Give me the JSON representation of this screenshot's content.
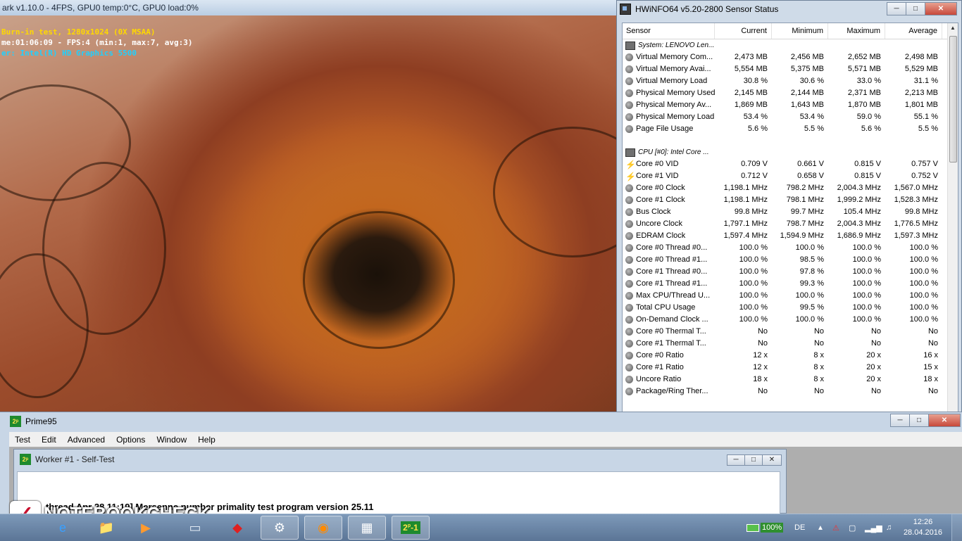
{
  "furmark": {
    "title": "ark v1.10.0 - 4FPS, GPU0 temp:0°C, GPU0 load:0%",
    "line1": "Burn-in test, 1280x1024 (0X MSAA)",
    "line2": "me:01:06:09 - FPS:4 (min:1, max:7, avg:3)",
    "line3": "er: Intel(R) HD Graphics 5500"
  },
  "hwinfo": {
    "title": "HWiNFO64 v5.20-2800 Sensor Status",
    "columns": [
      "Sensor",
      "Current",
      "Minimum",
      "Maximum",
      "Average"
    ],
    "group1": "System: LENOVO Len...",
    "group1_rows": [
      {
        "icon": "sensor-icon",
        "name": "Virtual Memory Com...",
        "current": "2,473 MB",
        "min": "2,456 MB",
        "max": "2,652 MB",
        "avg": "2,498 MB"
      },
      {
        "icon": "sensor-icon",
        "name": "Virtual Memory Avai...",
        "current": "5,554 MB",
        "min": "5,375 MB",
        "max": "5,571 MB",
        "avg": "5,529 MB"
      },
      {
        "icon": "sensor-icon",
        "name": "Virtual Memory Load",
        "current": "30.8 %",
        "min": "30.6 %",
        "max": "33.0 %",
        "avg": "31.1 %"
      },
      {
        "icon": "sensor-icon",
        "name": "Physical Memory Used",
        "current": "2,145 MB",
        "min": "2,144 MB",
        "max": "2,371 MB",
        "avg": "2,213 MB"
      },
      {
        "icon": "sensor-icon",
        "name": "Physical Memory Av...",
        "current": "1,869 MB",
        "min": "1,643 MB",
        "max": "1,870 MB",
        "avg": "1,801 MB"
      },
      {
        "icon": "sensor-icon",
        "name": "Physical Memory Load",
        "current": "53.4 %",
        "min": "53.4 %",
        "max": "59.0 %",
        "avg": "55.1 %"
      },
      {
        "icon": "sensor-icon",
        "name": "Page File Usage",
        "current": "5.6 %",
        "min": "5.5 %",
        "max": "5.6 %",
        "avg": "5.5 %"
      }
    ],
    "group2": "CPU [#0]: Intel Core ...",
    "group2_rows": [
      {
        "icon": "voltage-icon",
        "name": "Core #0 VID",
        "current": "0.709 V",
        "min": "0.661 V",
        "max": "0.815 V",
        "avg": "0.757 V"
      },
      {
        "icon": "voltage-icon",
        "name": "Core #1 VID",
        "current": "0.712 V",
        "min": "0.658 V",
        "max": "0.815 V",
        "avg": "0.752 V"
      },
      {
        "icon": "sensor-icon",
        "name": "Core #0 Clock",
        "current": "1,198.1 MHz",
        "min": "798.2 MHz",
        "max": "2,004.3 MHz",
        "avg": "1,567.0 MHz"
      },
      {
        "icon": "sensor-icon",
        "name": "Core #1 Clock",
        "current": "1,198.1 MHz",
        "min": "798.1 MHz",
        "max": "1,999.2 MHz",
        "avg": "1,528.3 MHz"
      },
      {
        "icon": "sensor-icon",
        "name": "Bus Clock",
        "current": "99.8 MHz",
        "min": "99.7 MHz",
        "max": "105.4 MHz",
        "avg": "99.8 MHz"
      },
      {
        "icon": "sensor-icon",
        "name": "Uncore Clock",
        "current": "1,797.1 MHz",
        "min": "798.7 MHz",
        "max": "2,004.3 MHz",
        "avg": "1,776.5 MHz"
      },
      {
        "icon": "sensor-icon",
        "name": "EDRAM Clock",
        "current": "1,597.4 MHz",
        "min": "1,594.9 MHz",
        "max": "1,686.9 MHz",
        "avg": "1,597.3 MHz"
      },
      {
        "icon": "sensor-icon",
        "name": "Core #0 Thread #0...",
        "current": "100.0 %",
        "min": "100.0 %",
        "max": "100.0 %",
        "avg": "100.0 %"
      },
      {
        "icon": "sensor-icon",
        "name": "Core #0 Thread #1...",
        "current": "100.0 %",
        "min": "98.5 %",
        "max": "100.0 %",
        "avg": "100.0 %"
      },
      {
        "icon": "sensor-icon",
        "name": "Core #1 Thread #0...",
        "current": "100.0 %",
        "min": "97.8 %",
        "max": "100.0 %",
        "avg": "100.0 %"
      },
      {
        "icon": "sensor-icon",
        "name": "Core #1 Thread #1...",
        "current": "100.0 %",
        "min": "99.3 %",
        "max": "100.0 %",
        "avg": "100.0 %"
      },
      {
        "icon": "sensor-icon",
        "name": "Max CPU/Thread U...",
        "current": "100.0 %",
        "min": "100.0 %",
        "max": "100.0 %",
        "avg": "100.0 %"
      },
      {
        "icon": "sensor-icon",
        "name": "Total CPU Usage",
        "current": "100.0 %",
        "min": "99.5 %",
        "max": "100.0 %",
        "avg": "100.0 %"
      },
      {
        "icon": "sensor-icon",
        "name": "On-Demand Clock ...",
        "current": "100.0 %",
        "min": "100.0 %",
        "max": "100.0 %",
        "avg": "100.0 %"
      },
      {
        "icon": "sensor-icon",
        "name": "Core #0 Thermal T...",
        "current": "No",
        "min": "No",
        "max": "No",
        "avg": "No"
      },
      {
        "icon": "sensor-icon",
        "name": "Core #1 Thermal T...",
        "current": "No",
        "min": "No",
        "max": "No",
        "avg": "No"
      },
      {
        "icon": "sensor-icon",
        "name": "Core #0 Ratio",
        "current": "12 x",
        "min": "8 x",
        "max": "20 x",
        "avg": "16 x"
      },
      {
        "icon": "sensor-icon",
        "name": "Core #1 Ratio",
        "current": "12 x",
        "min": "8 x",
        "max": "20 x",
        "avg": "15 x"
      },
      {
        "icon": "sensor-icon",
        "name": "Uncore Ratio",
        "current": "18 x",
        "min": "8 x",
        "max": "20 x",
        "avg": "18 x"
      },
      {
        "icon": "sensor-icon",
        "name": "Package/Ring Ther...",
        "current": "No",
        "min": "No",
        "max": "No",
        "avg": "No"
      }
    ]
  },
  "prime95": {
    "title": "Prime95",
    "menu": [
      "Test",
      "Edit",
      "Advanced",
      "Options",
      "Window",
      "Help"
    ],
    "worker_title": "Worker #1 - Self-Test",
    "log_line": "thread Apr 28 11:19] Mersenne number primality test program version 25.11"
  },
  "watermark": {
    "check": "✓",
    "text": "NOTEBOOKCHECK"
  },
  "taskbar": {
    "apps": [
      "ie",
      "explorer",
      "media-player",
      "monitor",
      "3dmark",
      "steam",
      "furmark",
      "hwinfo",
      "prime95"
    ],
    "battery": "100%",
    "language": "DE",
    "time": "12:26",
    "date": "28.04.2016"
  }
}
